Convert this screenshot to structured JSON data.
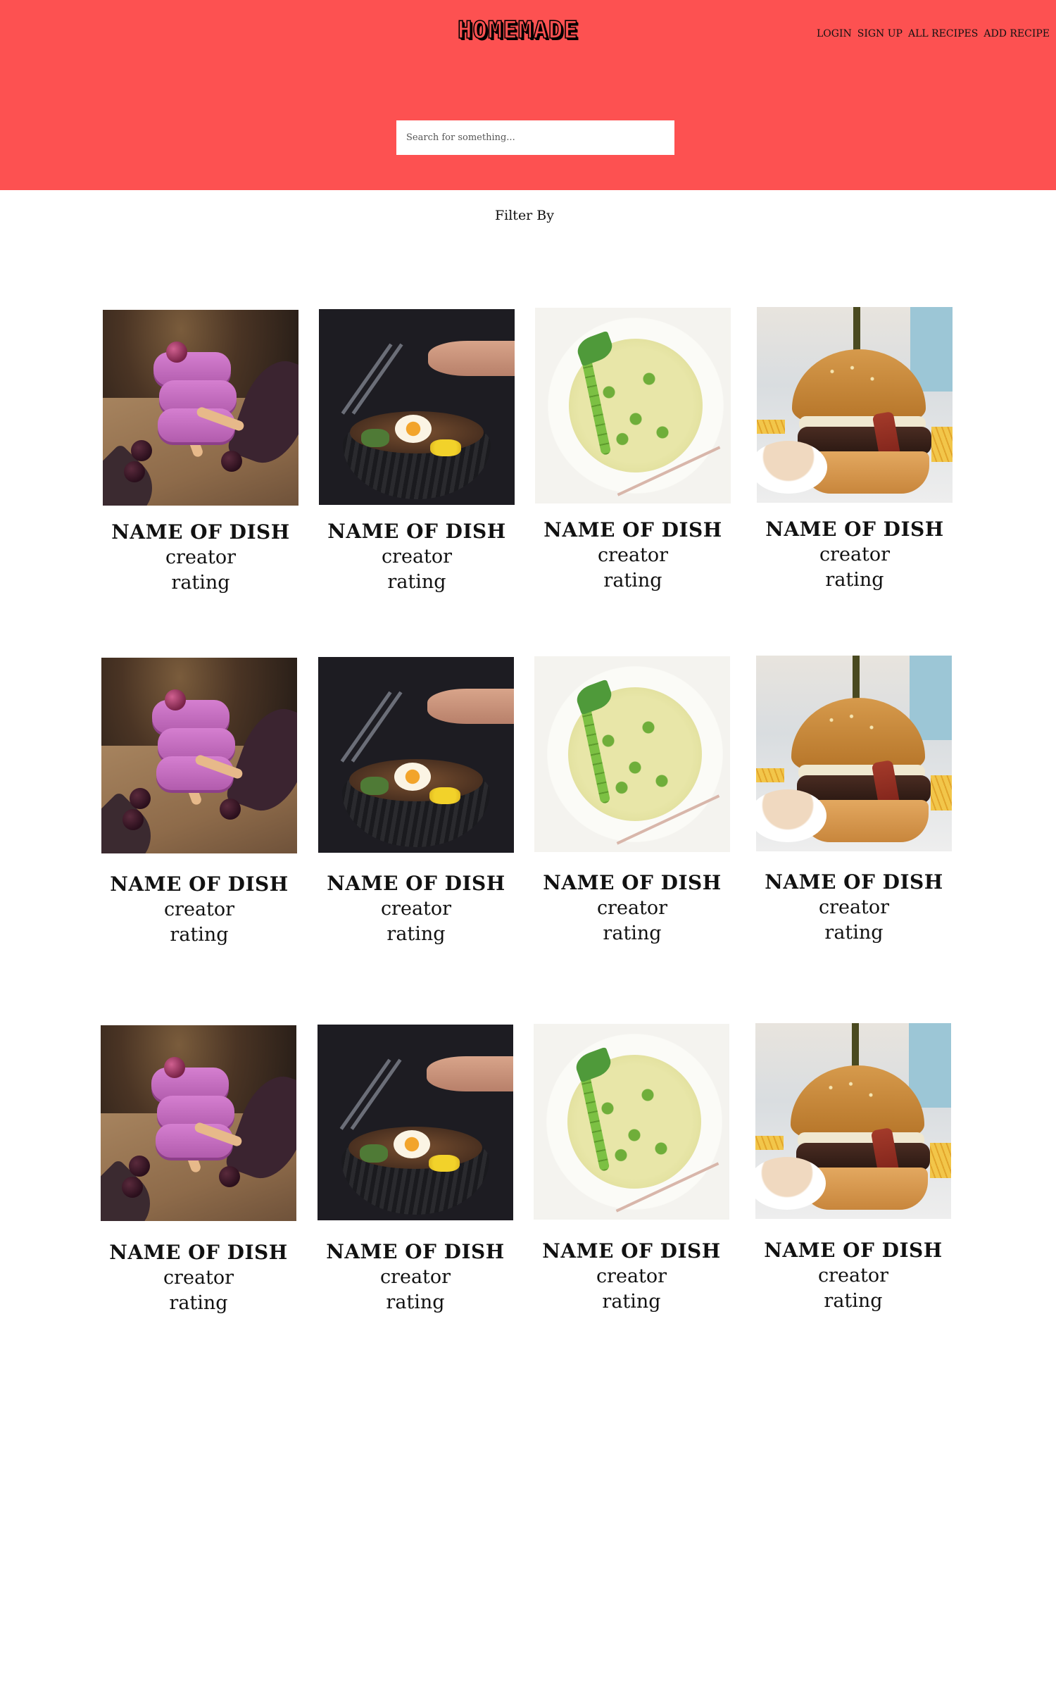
{
  "header": {
    "logo": "HOMEMADE",
    "nav": [
      "LOGIN",
      "SIGN UP",
      "ALL RECIPES",
      "ADD RECIPE"
    ],
    "search_placeholder": "Search for something...",
    "background_color": "#fd5151"
  },
  "filter": {
    "label": "Filter By"
  },
  "recipes": [
    [
      {
        "name": "NAME OF DISH",
        "creator": "creator",
        "rating": "rating",
        "image": "berry-popsicles"
      },
      {
        "name": "NAME OF DISH",
        "creator": "creator",
        "rating": "rating",
        "image": "ramen-bowl"
      },
      {
        "name": "NAME OF DISH",
        "creator": "creator",
        "rating": "rating",
        "image": "pea-pasta"
      },
      {
        "name": "NAME OF DISH",
        "creator": "creator",
        "rating": "rating",
        "image": "burger"
      }
    ],
    [
      {
        "name": "NAME OF DISH",
        "creator": "creator",
        "rating": "rating",
        "image": "berry-popsicles"
      },
      {
        "name": "NAME OF DISH",
        "creator": "creator",
        "rating": "rating",
        "image": "ramen-bowl"
      },
      {
        "name": "NAME OF DISH",
        "creator": "creator",
        "rating": "rating",
        "image": "pea-pasta"
      },
      {
        "name": "NAME OF DISH",
        "creator": "creator",
        "rating": "rating",
        "image": "burger"
      }
    ],
    [
      {
        "name": "NAME OF DISH",
        "creator": "creator",
        "rating": "rating",
        "image": "berry-popsicles"
      },
      {
        "name": "NAME OF DISH",
        "creator": "creator",
        "rating": "rating",
        "image": "ramen-bowl"
      },
      {
        "name": "NAME OF DISH",
        "creator": "creator",
        "rating": "rating",
        "image": "pea-pasta"
      },
      {
        "name": "NAME OF DISH",
        "creator": "creator",
        "rating": "rating",
        "image": "burger"
      }
    ]
  ]
}
